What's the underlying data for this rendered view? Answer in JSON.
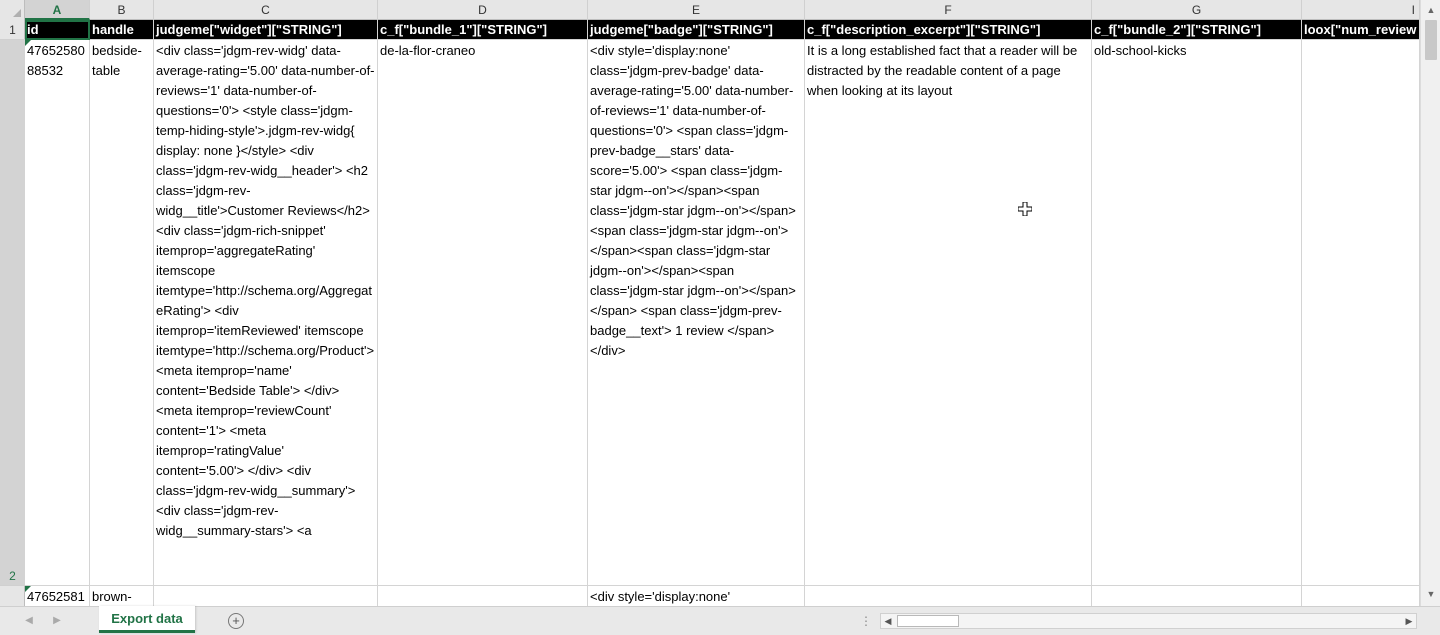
{
  "columns": [
    "A",
    "B",
    "C",
    "D",
    "E",
    "F",
    "G",
    "I"
  ],
  "rows": [
    "1",
    "2"
  ],
  "header_row": [
    "id",
    "handle",
    "judgeme[\"widget\"][\"STRING\"]",
    "c_f[\"bundle_1\"][\"STRING\"]",
    "judgeme[\"badge\"][\"STRING\"]",
    "c_f[\"description_excerpt\"][\"STRING\"]",
    "c_f[\"bundle_2\"][\"STRING\"]",
    "loox[\"num_review"
  ],
  "row2": {
    "id": "4765258088532",
    "handle": "bedside-table",
    "widget": "<div class='jdgm-rev-widg' data-average-rating='5.00' data-number-of-reviews='1' data-number-of-questions='0'> <style class='jdgm-temp-hiding-style'>.jdgm-rev-widg{ display: none }</style> <div class='jdgm-rev-widg__header'> <h2 class='jdgm-rev-widg__title'>Customer Reviews</h2>   <div class='jdgm-rich-snippet' itemprop='aggregateRating' itemscope itemtype='http://schema.org/AggregateRating'> <div itemprop='itemReviewed' itemscope itemtype='http://schema.org/Product'> <meta itemprop='name' content='Bedside Table'> </div> <meta itemprop='reviewCount' content='1'> <meta itemprop='ratingValue' content='5.00'> </div>   <div class='jdgm-rev-widg__summary'> <div class='jdgm-rev-widg__summary-stars'> <a",
    "bundle_1": "de-la-flor-craneo",
    "badge": "<div style='display:none' class='jdgm-prev-badge' data-average-rating='5.00' data-number-of-reviews='1' data-number-of-questions='0'> <span class='jdgm-prev-badge__stars' data-score='5.00'> <span class='jdgm-star jdgm--on'></span><span class='jdgm-star jdgm--on'></span><span class='jdgm-star jdgm--on'></span><span class='jdgm-star jdgm--on'></span><span class='jdgm-star jdgm--on'></span> </span> <span class='jdgm-prev-badge__text'> 1 review </span> </div>",
    "description_excerpt": "It is a long established fact that a reader will be distracted by the readable content of a page when looking at its layout",
    "bundle_2": "old-school-kicks"
  },
  "row3": {
    "id": "47652581",
    "handle": "brown-",
    "badge": "<div style='display:none'"
  },
  "sheet_tab": "Export data",
  "icons": {
    "add_sheet": "plus-circle-icon",
    "cursor": "cell-cursor-icon"
  },
  "colors": {
    "accent": "#217346",
    "header_bg": "#000000",
    "header_text": "#ffffff"
  }
}
